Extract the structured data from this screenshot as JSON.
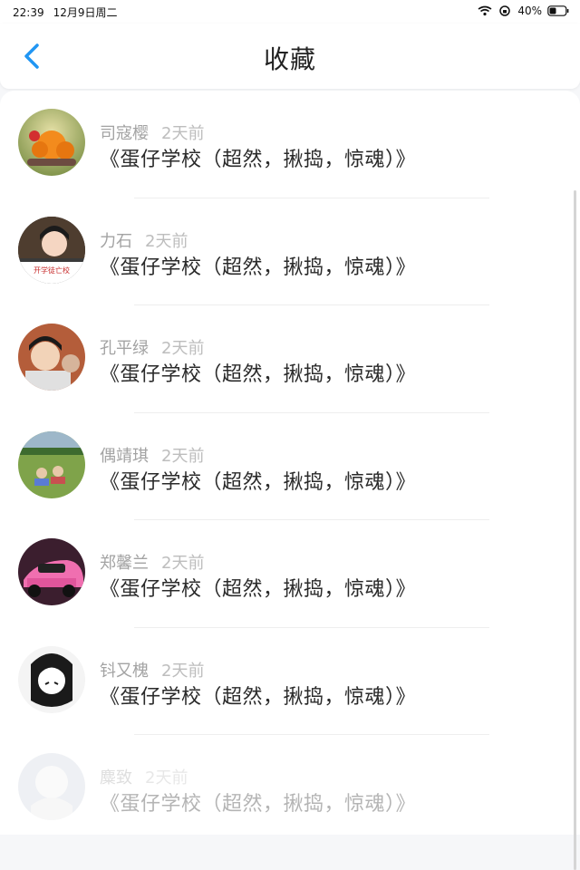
{
  "status_bar": {
    "time": "22:39",
    "date": "12月9日周二",
    "battery": "40%"
  },
  "header": {
    "title": "收藏"
  },
  "items": [
    {
      "name": "司寇樱",
      "time": "2天前",
      "title": "《蛋仔学校（超然，揪捣，惊魂）》"
    },
    {
      "name": "力石",
      "time": "2天前",
      "title": "《蛋仔学校（超然，揪捣，惊魂）》",
      "avatar_caption": "开学徒亡校"
    },
    {
      "name": "孔平绿",
      "time": "2天前",
      "title": "《蛋仔学校（超然，揪捣，惊魂）》"
    },
    {
      "name": "偶靖琪",
      "time": "2天前",
      "title": "《蛋仔学校（超然，揪捣，惊魂）》"
    },
    {
      "name": "郑馨兰",
      "time": "2天前",
      "title": "《蛋仔学校（超然，揪捣，惊魂）》"
    },
    {
      "name": "钭又槐",
      "time": "2天前",
      "title": "《蛋仔学校（超然，揪捣，惊魂）》"
    },
    {
      "name": "麋致",
      "time": "2天前",
      "title": "《蛋仔学校（超然，揪捣，惊魂）》"
    }
  ],
  "colors": {
    "accent": "#2196f3",
    "background": "#f6f7f9",
    "text": "#2a2a2a",
    "muted": "#a3a3a3"
  }
}
